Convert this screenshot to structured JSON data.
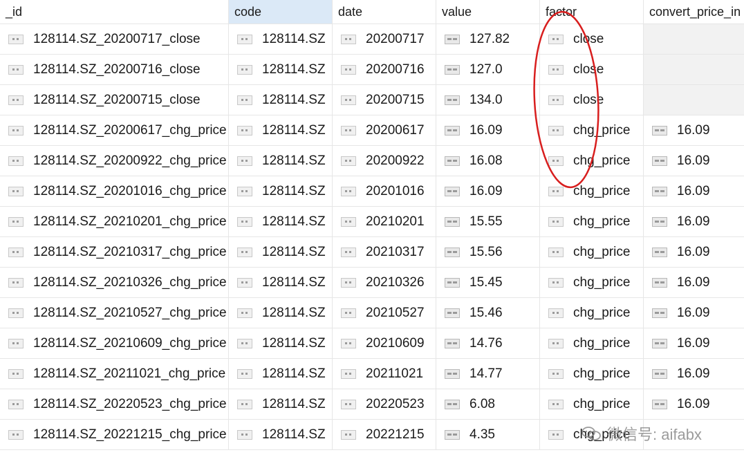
{
  "columns": [
    {
      "label": "_id"
    },
    {
      "label": "code"
    },
    {
      "label": "date"
    },
    {
      "label": "value"
    },
    {
      "label": "factor"
    },
    {
      "label": "convert_price_in"
    }
  ],
  "rows": [
    {
      "id": "128114.SZ_20200717_close",
      "code": "128114.SZ",
      "date": "20200717",
      "value": "127.82",
      "factor": "close",
      "convert_price": ""
    },
    {
      "id": "128114.SZ_20200716_close",
      "code": "128114.SZ",
      "date": "20200716",
      "value": "127.0",
      "factor": "close",
      "convert_price": ""
    },
    {
      "id": "128114.SZ_20200715_close",
      "code": "128114.SZ",
      "date": "20200715",
      "value": "134.0",
      "factor": "close",
      "convert_price": ""
    },
    {
      "id": "128114.SZ_20200617_chg_price",
      "code": "128114.SZ",
      "date": "20200617",
      "value": "16.09",
      "factor": "chg_price",
      "convert_price": "16.09"
    },
    {
      "id": "128114.SZ_20200922_chg_price",
      "code": "128114.SZ",
      "date": "20200922",
      "value": "16.08",
      "factor": "chg_price",
      "convert_price": "16.09"
    },
    {
      "id": "128114.SZ_20201016_chg_price",
      "code": "128114.SZ",
      "date": "20201016",
      "value": "16.09",
      "factor": "chg_price",
      "convert_price": "16.09"
    },
    {
      "id": "128114.SZ_20210201_chg_price",
      "code": "128114.SZ",
      "date": "20210201",
      "value": "15.55",
      "factor": "chg_price",
      "convert_price": "16.09"
    },
    {
      "id": "128114.SZ_20210317_chg_price",
      "code": "128114.SZ",
      "date": "20210317",
      "value": "15.56",
      "factor": "chg_price",
      "convert_price": "16.09"
    },
    {
      "id": "128114.SZ_20210326_chg_price",
      "code": "128114.SZ",
      "date": "20210326",
      "value": "15.45",
      "factor": "chg_price",
      "convert_price": "16.09"
    },
    {
      "id": "128114.SZ_20210527_chg_price",
      "code": "128114.SZ",
      "date": "20210527",
      "value": "15.46",
      "factor": "chg_price",
      "convert_price": "16.09"
    },
    {
      "id": "128114.SZ_20210609_chg_price",
      "code": "128114.SZ",
      "date": "20210609",
      "value": "14.76",
      "factor": "chg_price",
      "convert_price": "16.09"
    },
    {
      "id": "128114.SZ_20211021_chg_price",
      "code": "128114.SZ",
      "date": "20211021",
      "value": "14.77",
      "factor": "chg_price",
      "convert_price": "16.09"
    },
    {
      "id": "128114.SZ_20220523_chg_price",
      "code": "128114.SZ",
      "date": "20220523",
      "value": "6.08",
      "factor": "chg_price",
      "convert_price": "16.09"
    },
    {
      "id": "128114.SZ_20221215_chg_price",
      "code": "128114.SZ",
      "date": "20221215",
      "value": "4.35",
      "factor": "chg_price",
      "convert_price": ""
    }
  ],
  "watermark": {
    "text": "微信号: aifabx"
  },
  "colors": {
    "annotation": "#d81e1e",
    "active_header": "#dbe9f7"
  },
  "icons": {
    "field_type": "string-field-icon",
    "number_type": "number-field-icon"
  }
}
